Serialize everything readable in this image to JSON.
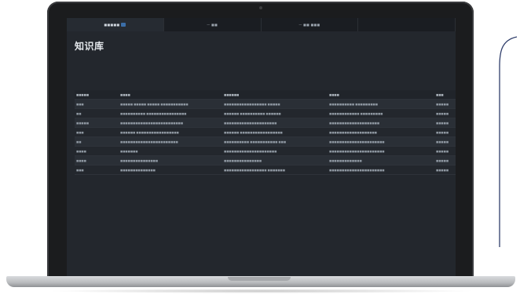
{
  "screen": {
    "tabs": [
      {
        "label": "■■■■■",
        "active": true
      },
      {
        "label": "— ■■",
        "active": false
      },
      {
        "label": "— ■■ ■■■",
        "active": false
      },
      {
        "label": "",
        "active": false
      }
    ],
    "page_title": "知识库"
  },
  "table": {
    "headers": [
      "■■■■■",
      "■■■■",
      "■■■■■■",
      "■■■■",
      "■■■"
    ],
    "rows": [
      [
        "■■■",
        "■■■■■ ■■■■■ ■■■■■ ■■■■■■■■■■■",
        "■■■■■■■■■■■■■■■■■ ■■■■■",
        "■■■■■■■■■■ ■■■■■■■■■",
        "■■■■■"
      ],
      [
        "■■",
        "■■■■■■■■■■ ■■■■■■■■■■■■■■■■",
        "■■■■■■ ■■■■■■■■■■ ■■■■■■",
        "■■■■■■■■■■■■ ■■■■■■■■■",
        "■■■■■"
      ],
      [
        "■■■■■",
        "■■■■■■■■■■■■■■■■■■■■■■■■■",
        "■■■■■■■■■■■■■■■■■■■■■",
        "■■■■■■■■■■■■■■■■■■■■",
        "■■■■■"
      ],
      [
        "■■■",
        "■■■■■■ ■■■■■■■■■■■■■■■■■",
        "■■■■■■ ■■■■■■■■■■■■■■■■■",
        "■■■■■■■■■■■■■■■■■■■",
        "■■■■■"
      ],
      [
        "■■",
        "■■■■■■■■■■■■■■■■■■■■■■■",
        "■■■■■■■■■■ ■■■■■■■■■■■ ■■■",
        "■■■■■■■■■■■■■■■■■■■■■■",
        "■■■■■"
      ],
      [
        "■■■■",
        "■■■■■■■",
        "■■■■■■■■■■■■■■■■■■■■■",
        "■■■■■■■■■■■■■■■■■■■■■■",
        "■■■■■"
      ],
      [
        "■■■■",
        "■■■■■■■■■■■■■■■",
        "■■■■■■■■■■■■■■■",
        "■■■■■■■■■■■■■",
        "■■■■■"
      ],
      [
        "■■■",
        "■■■■■■■■■■■■■■",
        "■■■■■■■■■■■■■■■■■ ■■■■■■■",
        "■■■■■■■■■■■■■■■■■■■■■■",
        "■■■■■"
      ]
    ]
  }
}
